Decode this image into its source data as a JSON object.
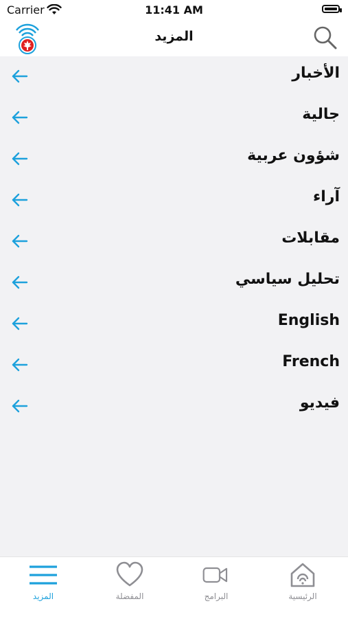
{
  "status": {
    "carrier": "Carrier",
    "time": "11:41 AM"
  },
  "nav": {
    "title": "المزيد"
  },
  "menu": [
    {
      "label": "الأخبار"
    },
    {
      "label": "جالية"
    },
    {
      "label": "شؤون عربية"
    },
    {
      "label": "آراء"
    },
    {
      "label": "مقابلات"
    },
    {
      "label": "تحليل سياسي"
    },
    {
      "label": "English"
    },
    {
      "label": "French"
    },
    {
      "label": "فيديو"
    }
  ],
  "tabs": {
    "more": "المزيد",
    "favorites": "المفضلة",
    "programs": "البرامج",
    "home": "الرئيسية"
  },
  "colors": {
    "accent": "#1da1dc",
    "inactive": "#8e8e93",
    "list_bg": "#f2f2f4"
  }
}
